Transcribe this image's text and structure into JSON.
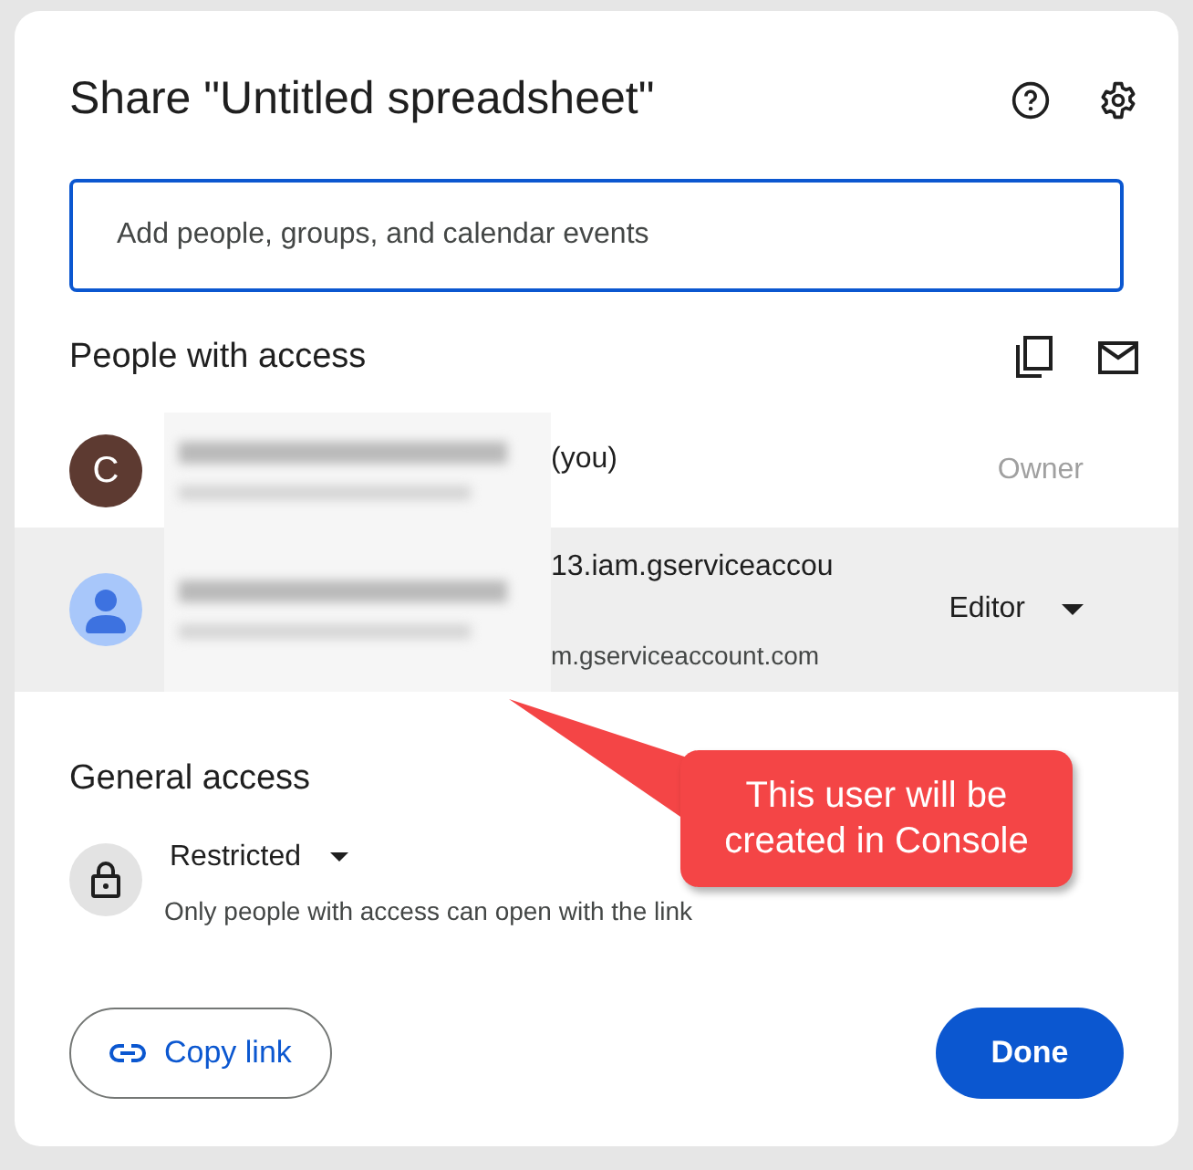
{
  "dialog": {
    "title": "Share \"Untitled spreadsheet\"",
    "search": {
      "placeholder": "Add people, groups, and calendar events"
    },
    "people_heading": "People with access",
    "people": [
      {
        "kind": "letter",
        "initial": "C",
        "name": "(you)",
        "role": {
          "kind": "static",
          "text": "Owner"
        },
        "highlighted": false
      },
      {
        "kind": "silhouette",
        "name": "13.iam.gserviceaccou",
        "email": "m.gserviceaccount.com",
        "role": {
          "kind": "dropdown",
          "text": "Editor"
        },
        "highlighted": true
      }
    ],
    "general_heading": "General access",
    "general": {
      "option": "Restricted",
      "description": "Only people with access can open with the link"
    },
    "copy_link": "Copy link",
    "done": "Done"
  },
  "callout": {
    "text": "This user will be created in Console"
  }
}
